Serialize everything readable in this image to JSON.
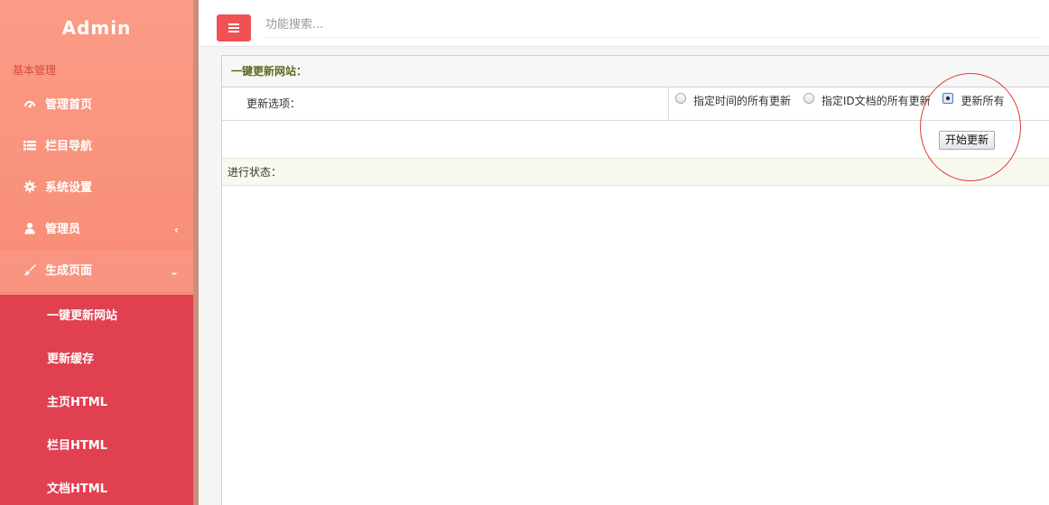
{
  "sidebar": {
    "brand": "Admin",
    "section_label": "基本管理",
    "items": [
      {
        "label": "管理首页",
        "icon": "dashboard-icon"
      },
      {
        "label": "栏目导航",
        "icon": "list-icon"
      },
      {
        "label": "系统设置",
        "icon": "gear-icon"
      },
      {
        "label": "管理员",
        "icon": "user-icon",
        "arrow": "‹"
      },
      {
        "label": "生成页面",
        "icon": "brush-icon",
        "arrow": "⌄"
      }
    ],
    "submenu": [
      {
        "label": "一键更新网站"
      },
      {
        "label": "更新缓存"
      },
      {
        "label": "主页HTML"
      },
      {
        "label": "栏目HTML"
      },
      {
        "label": "文档HTML"
      }
    ]
  },
  "topbar": {
    "search_placeholder": "功能搜索..."
  },
  "panel": {
    "title": "一键更新网站：",
    "options_label": "更新选项：",
    "options": [
      {
        "label": "指定时间的所有更新",
        "checked": false
      },
      {
        "label": "指定ID文档的所有更新",
        "checked": false
      },
      {
        "label": "更新所有",
        "checked": true
      }
    ],
    "start_button": "开始更新",
    "status_label": "进行状态："
  },
  "colors": {
    "accent": "#ef5155",
    "submenu_bg": "#e04050",
    "highlight": "#e23a3a"
  }
}
